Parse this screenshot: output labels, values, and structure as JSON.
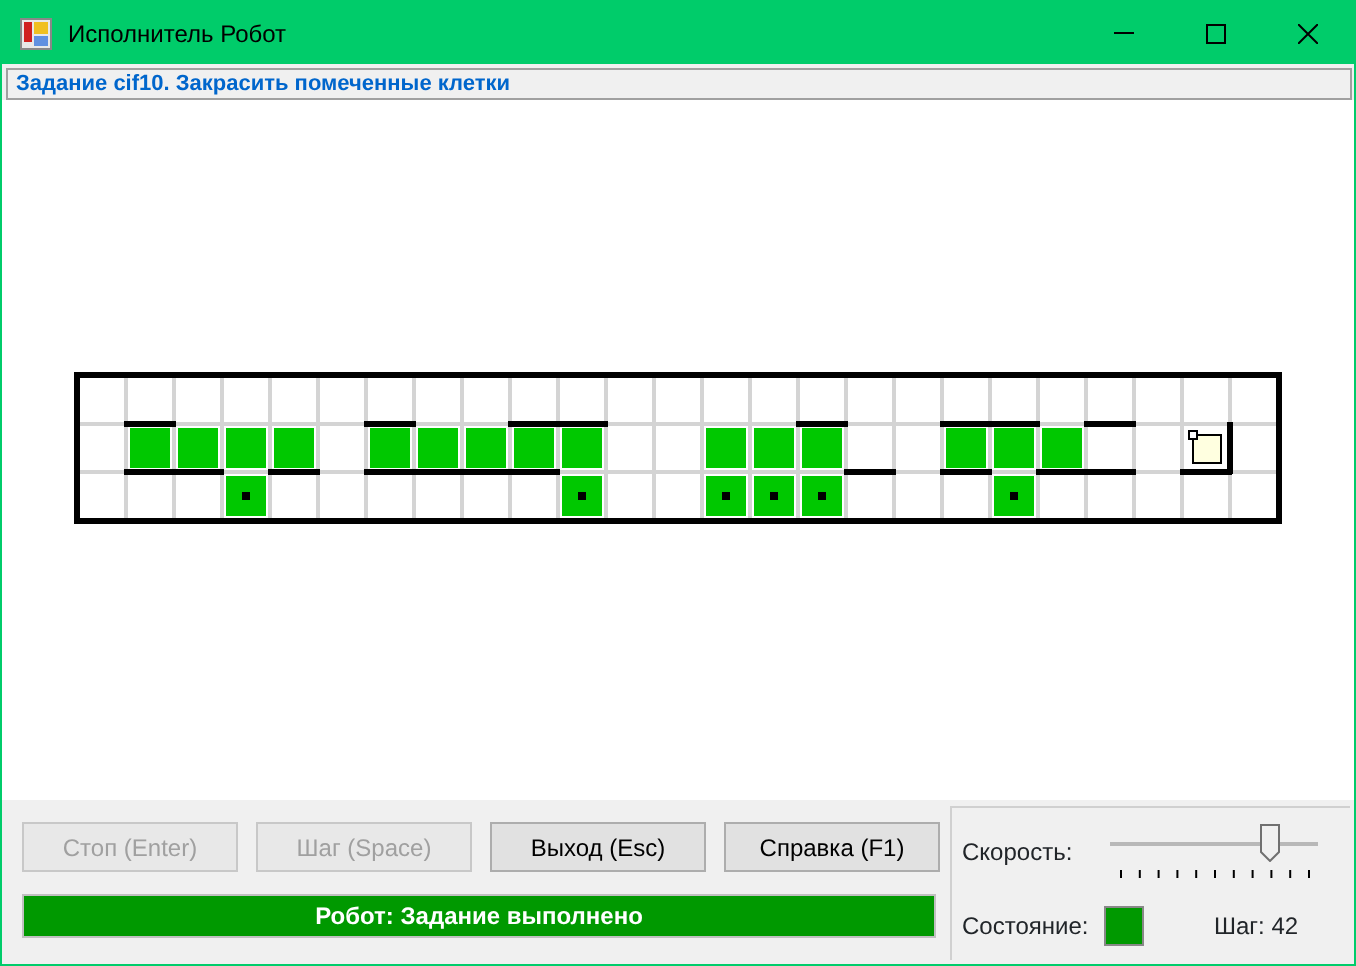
{
  "window": {
    "title": "Исполнитель Робот"
  },
  "task": "Задание cif10. Закрасить помеченные клетки",
  "field": {
    "rows": [
      {
        "cells": [
          {
            "painted": false,
            "marked": false
          },
          {
            "painted": false,
            "marked": false
          },
          {
            "painted": false,
            "marked": false
          },
          {
            "painted": false,
            "marked": false
          },
          {
            "painted": false,
            "marked": false
          },
          {
            "painted": false,
            "marked": false
          },
          {
            "painted": false,
            "marked": false
          },
          {
            "painted": false,
            "marked": false
          },
          {
            "painted": false,
            "marked": false
          },
          {
            "painted": false,
            "marked": false
          },
          {
            "painted": false,
            "marked": false
          },
          {
            "painted": false,
            "marked": false
          },
          {
            "painted": false,
            "marked": false
          },
          {
            "painted": false,
            "marked": false
          },
          {
            "painted": false,
            "marked": false
          },
          {
            "painted": false,
            "marked": false
          },
          {
            "painted": false,
            "marked": false
          },
          {
            "painted": false,
            "marked": false
          },
          {
            "painted": false,
            "marked": false
          },
          {
            "painted": false,
            "marked": false
          },
          {
            "painted": false,
            "marked": false
          },
          {
            "painted": false,
            "marked": false
          },
          {
            "painted": false,
            "marked": false
          },
          {
            "painted": false,
            "marked": false
          },
          {
            "painted": false,
            "marked": false
          }
        ]
      },
      {
        "cells": [
          {
            "painted": false,
            "marked": false
          },
          {
            "painted": true,
            "marked": false,
            "wall_top": true,
            "wall_bottom": true
          },
          {
            "painted": true,
            "marked": false,
            "wall_bottom": true
          },
          {
            "painted": true,
            "marked": false
          },
          {
            "painted": true,
            "marked": false,
            "wall_bottom": true
          },
          {
            "painted": false,
            "marked": false
          },
          {
            "painted": true,
            "marked": false,
            "wall_top": true,
            "wall_bottom": true
          },
          {
            "painted": true,
            "marked": false,
            "wall_bottom": true
          },
          {
            "painted": true,
            "marked": false,
            "wall_bottom": true
          },
          {
            "painted": true,
            "marked": false,
            "wall_top": true,
            "wall_bottom": true
          },
          {
            "painted": true,
            "marked": false,
            "wall_top": true
          },
          {
            "painted": false,
            "marked": false
          },
          {
            "painted": false,
            "marked": false
          },
          {
            "painted": true,
            "marked": false
          },
          {
            "painted": true,
            "marked": false
          },
          {
            "painted": true,
            "marked": false,
            "wall_top": true
          },
          {
            "painted": false,
            "marked": false,
            "wall_bottom": true
          },
          {
            "painted": false,
            "marked": false
          },
          {
            "painted": true,
            "marked": false,
            "wall_top": true,
            "wall_bottom": true
          },
          {
            "painted": true,
            "marked": false,
            "wall_top": true
          },
          {
            "painted": true,
            "marked": false,
            "wall_bottom": true
          },
          {
            "painted": false,
            "marked": false,
            "wall_top": true,
            "wall_bottom": true
          },
          {
            "painted": false,
            "marked": false
          },
          {
            "painted": false,
            "marked": false,
            "robot": true,
            "wall_bottom": true,
            "wall_right": true
          },
          {
            "painted": false,
            "marked": false
          }
        ]
      },
      {
        "cells": [
          {
            "painted": false,
            "marked": false
          },
          {
            "painted": false,
            "marked": false
          },
          {
            "painted": false,
            "marked": false
          },
          {
            "painted": true,
            "marked": true
          },
          {
            "painted": false,
            "marked": false
          },
          {
            "painted": false,
            "marked": false
          },
          {
            "painted": false,
            "marked": false
          },
          {
            "painted": false,
            "marked": false
          },
          {
            "painted": false,
            "marked": false
          },
          {
            "painted": false,
            "marked": false
          },
          {
            "painted": true,
            "marked": true
          },
          {
            "painted": false,
            "marked": false
          },
          {
            "painted": false,
            "marked": false
          },
          {
            "painted": true,
            "marked": true
          },
          {
            "painted": true,
            "marked": true
          },
          {
            "painted": true,
            "marked": true
          },
          {
            "painted": false,
            "marked": false
          },
          {
            "painted": false,
            "marked": false
          },
          {
            "painted": false,
            "marked": false
          },
          {
            "painted": true,
            "marked": true
          },
          {
            "painted": false,
            "marked": false
          },
          {
            "painted": false,
            "marked": false
          },
          {
            "painted": false,
            "marked": false
          },
          {
            "painted": false,
            "marked": false
          },
          {
            "painted": false,
            "marked": false
          }
        ]
      }
    ]
  },
  "buttons": [
    {
      "label": "Стоп (Enter)",
      "disabled": true
    },
    {
      "label": "Шаг (Space)",
      "disabled": true
    },
    {
      "label": "Выход (Esc)",
      "disabled": false
    },
    {
      "label": "Справка (F1)",
      "disabled": false
    }
  ],
  "status": "Робот: Задание выполнено",
  "speed": {
    "label": "Скорость:",
    "level": 0.8
  },
  "state": {
    "label": "Состояние:",
    "color": "#009900"
  },
  "step": "Шаг: 42"
}
